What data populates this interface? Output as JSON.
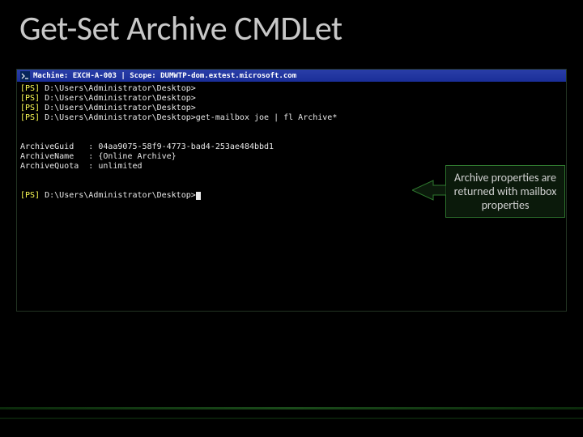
{
  "title": "Get-Set Archive CMDLet",
  "window": {
    "titlebar": "Machine: EXCH-A-003 | Scope: DUMWTP-dom.extest.microsoft.com"
  },
  "term": {
    "ps_prefix": "[PS]",
    "path": " D:\\Users\\Administrator\\Desktop>",
    "cmd": "get-mailbox joe | fl Archive*",
    "output": {
      "line1": "ArchiveGuid   : 04aa9075-58f9-4773-bad4-253ae484bbd1",
      "line2": "ArchiveName   : {Online Archive}",
      "line3": "ArchiveQuota  : unlimited"
    }
  },
  "callout": {
    "text": "Archive properties are returned with mailbox properties"
  }
}
